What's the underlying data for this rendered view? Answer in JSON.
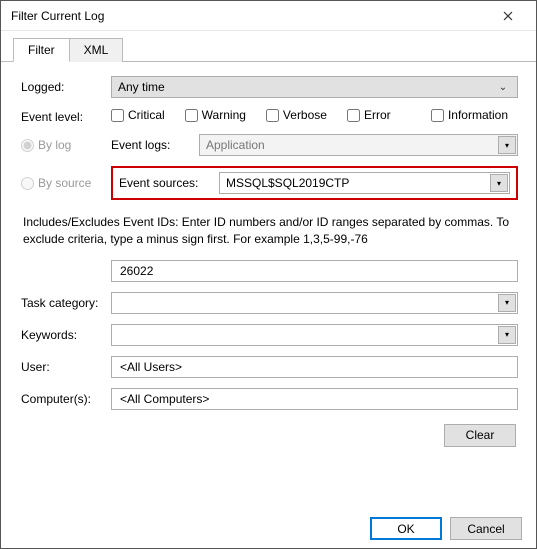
{
  "window": {
    "title": "Filter Current Log"
  },
  "tabs": {
    "filter": "Filter",
    "xml": "XML"
  },
  "labels": {
    "logged": "Logged:",
    "eventLevel": "Event level:",
    "byLog": "By log",
    "bySource": "By source",
    "eventLogs": "Event logs:",
    "eventSources": "Event sources:",
    "taskCategory": "Task category:",
    "keywords": "Keywords:",
    "user": "User:",
    "computers": "Computer(s):"
  },
  "values": {
    "logged": "Any time",
    "eventLogs": "Application",
    "eventSources": "MSSQL$SQL2019CTP",
    "eventIds": "26022",
    "taskCategory": "",
    "keywords": "",
    "user": "<All Users>",
    "computers": "<All Computers>"
  },
  "checkboxes": {
    "critical": "Critical",
    "warning": "Warning",
    "verbose": "Verbose",
    "error": "Error",
    "information": "Information"
  },
  "hint": "Includes/Excludes Event IDs: Enter ID numbers and/or ID ranges separated by commas. To exclude criteria, type a minus sign first. For example 1,3,5-99,-76",
  "buttons": {
    "clear": "Clear",
    "ok": "OK",
    "cancel": "Cancel"
  }
}
